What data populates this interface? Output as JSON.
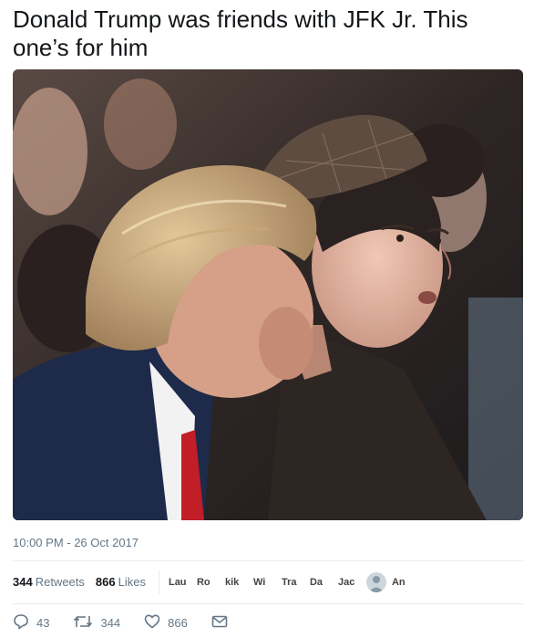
{
  "tweet": {
    "text": "Donald Trump was friends with JFK Jr. This one’s for him",
    "timestamp": "10:00 PM - 26 Oct 2017"
  },
  "stats": {
    "retweets_count": "344",
    "retweets_label": "Retweets",
    "likes_count": "866",
    "likes_label": "Likes"
  },
  "likers": [
    {
      "label": "Lau"
    },
    {
      "label": "Ro"
    },
    {
      "label": "kik"
    },
    {
      "label": "Wi"
    },
    {
      "label": "Tra"
    },
    {
      "label": "Da"
    },
    {
      "label": "Jac"
    },
    {
      "label": "",
      "icon": "default-avatar-icon"
    },
    {
      "label": "An"
    }
  ],
  "actions": {
    "reply_count": "43",
    "retweet_count": "344",
    "like_count": "866"
  },
  "icons": {
    "reply": "reply-icon",
    "retweet": "retweet-icon",
    "like": "heart-icon",
    "dm": "envelope-icon"
  },
  "colors": {
    "text": "#14171a",
    "muted": "#657786",
    "divider": "#e6ecf0"
  }
}
